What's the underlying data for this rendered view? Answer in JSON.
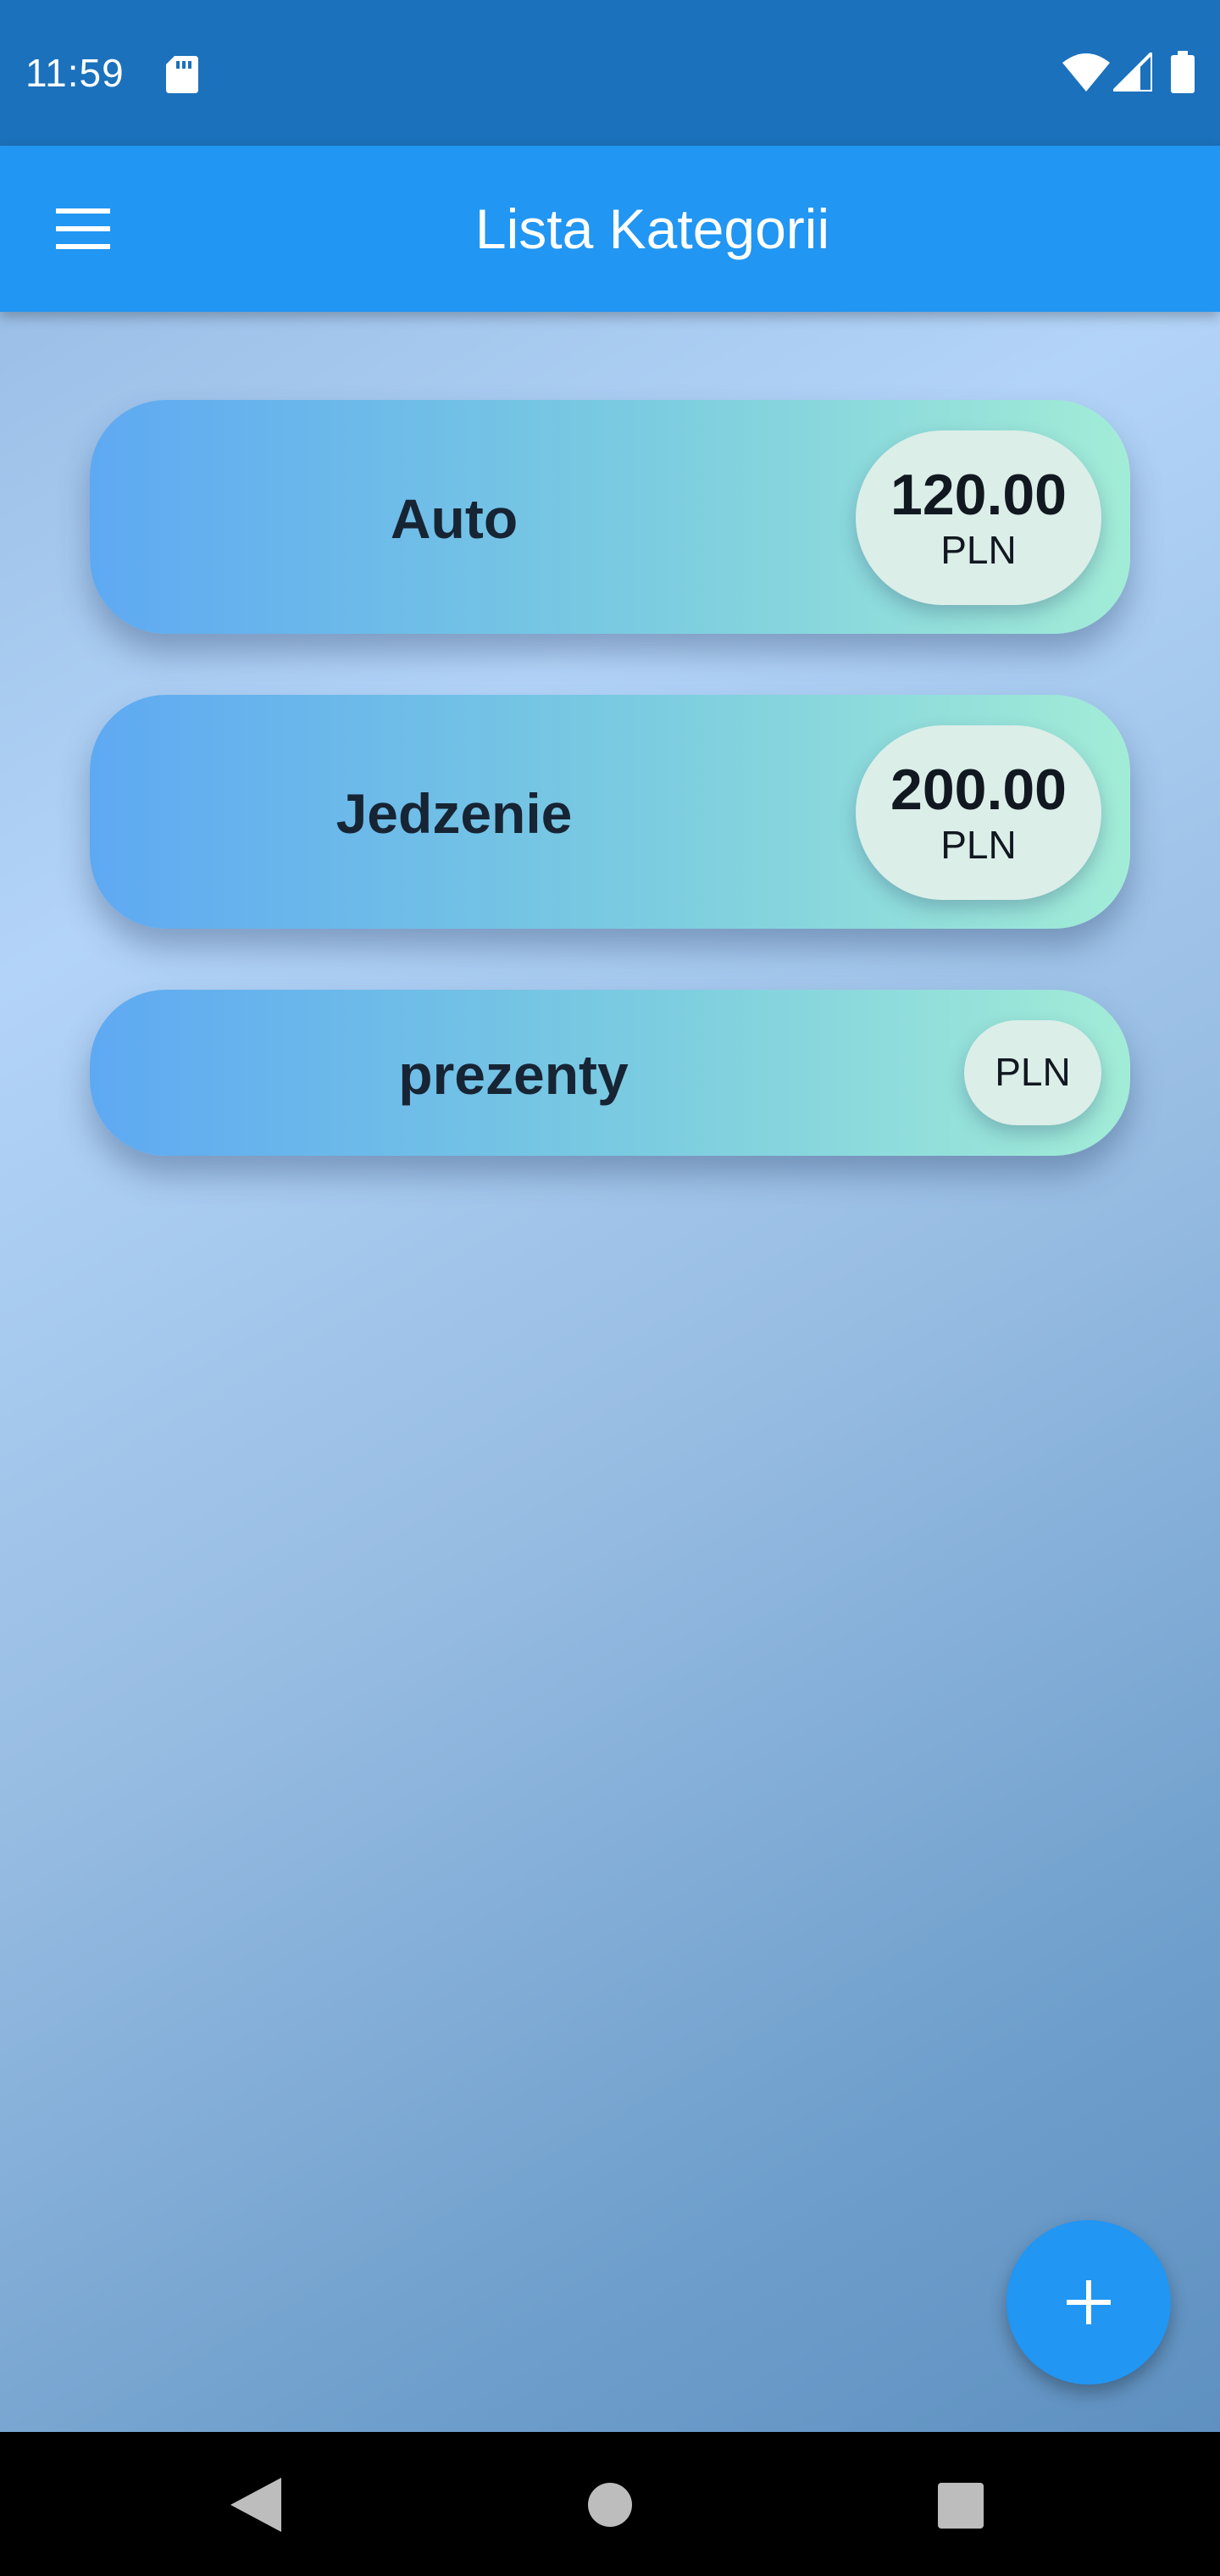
{
  "status_bar": {
    "time": "11:59",
    "icons": [
      "sd-card-icon",
      "wifi-icon",
      "signal-icon",
      "battery-icon"
    ]
  },
  "app_bar": {
    "title": "Lista Kategorii",
    "menu_icon": "menu-icon"
  },
  "categories": [
    {
      "name": "Auto",
      "amount": "120.00",
      "currency": "PLN"
    },
    {
      "name": "Jedzenie",
      "amount": "200.00",
      "currency": "PLN"
    },
    {
      "name": "prezenty",
      "amount": "",
      "currency": "PLN"
    }
  ],
  "fab": {
    "icon": "plus-icon"
  },
  "nav_bar": {
    "icons": [
      "back-icon",
      "home-icon",
      "recents-icon"
    ]
  },
  "colors": {
    "status_bar": "#1b71bb",
    "app_bar": "#2196f3",
    "fab": "#2196f3",
    "card_gradient_start": "#5ea9f2",
    "card_gradient_end": "#a2ecd7",
    "pill": "#dbeee8"
  }
}
